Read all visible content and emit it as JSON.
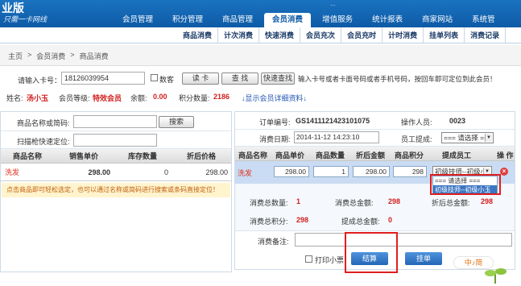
{
  "header": {
    "logo_text": "业版",
    "slogan": "只需一卡网线",
    "top_info": "...",
    "nav": [
      {
        "label": "会员管理",
        "active": false
      },
      {
        "label": "积分管理",
        "active": false
      },
      {
        "label": "商品管理",
        "active": false
      },
      {
        "label": "会员消费",
        "active": true
      },
      {
        "label": "增值服务",
        "active": false
      },
      {
        "label": "统计报表",
        "active": false
      },
      {
        "label": "商家网站",
        "active": false
      },
      {
        "label": "系统管",
        "active": false
      }
    ],
    "subnav": [
      "商品消费",
      "计次消费",
      "快速消费",
      "会员充次",
      "会员充时",
      "计时消费",
      "挂单列表",
      "消费记录"
    ]
  },
  "breadcrumb": [
    "主页",
    ">",
    "会员消费",
    ">",
    "商品消费"
  ],
  "card": {
    "label": "请输入卡号：",
    "value": "18126039954",
    "checkbox_label": "数客",
    "read_button": "读 卡",
    "search_button": "查 找",
    "quick_search_button": "快速查找",
    "hint": "输入卡号或者卡面号码或者手机号码，按回车即可定位到此会员！"
  },
  "member": {
    "name_label": "姓名:",
    "name": "汤小玉",
    "level_label": "会员等级:",
    "level": "特效会员",
    "balance_label": "余额:",
    "balance": "0.00",
    "points_label": "积分数量:",
    "points": "2186",
    "details_link": "↓显示会员详细资料↓"
  },
  "left": {
    "product_search_label": "商品名称或简码:",
    "search_button": "搜索",
    "scan_label": "扫描枪快速定位:",
    "table_headers": [
      "商品名称",
      "销售单价",
      "库存数量",
      "折后价格"
    ],
    "rows": [
      {
        "name": "洗发",
        "price": "298.00",
        "stock": "0",
        "discount": "298.00"
      }
    ],
    "tip": "点击商品即可轻松选定，也可以通过名称或简码进行搜索或条码直接定位！"
  },
  "right": {
    "order_label": "订单编号:",
    "order_no": "GS1411121423101075",
    "operator_label": "操作人员:",
    "operator": "0023",
    "date_label": "消费日期:",
    "date": "2014-11-12 14:23:10",
    "staff_label": "员工提成:",
    "staff_select": "=== 请选择 ===",
    "table_headers": [
      "商品名称",
      "商品单价",
      "商品数量",
      "折后金额",
      "商品积分",
      "提成员工",
      "操 作"
    ],
    "row": {
      "name": "洗发",
      "unit_price": "298.00",
      "qty": "1",
      "discount": "298.00",
      "points": "298",
      "employee": "初级技师--初级小"
    },
    "dropdown_options": [
      "=== 请选择 ===",
      "初级技师--初级小玉"
    ],
    "total_qty_label": "消费总数量:",
    "total_qty": "1",
    "total_amount_label": "消费总金额:",
    "total_amount": "298",
    "total_discount_label": "折后总金额:",
    "total_discount": "298",
    "total_points_label": "消费总积分:",
    "total_points": "298",
    "commission_label": "提成总金额:",
    "commission": "0",
    "remark_label": "消费备注:",
    "print_label": "打印小票",
    "checkout_button": "结算",
    "hold_button": "挂单"
  },
  "ime": {
    "label": "中♪简"
  }
}
